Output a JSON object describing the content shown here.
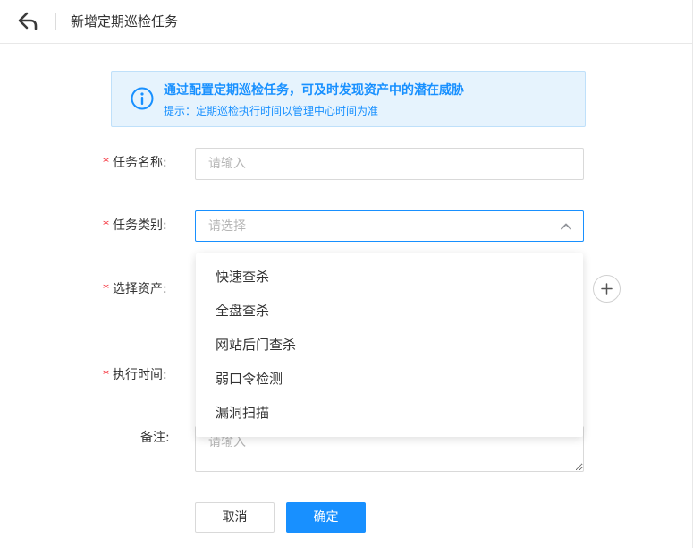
{
  "header": {
    "title": "新增定期巡检任务",
    "back_icon": "back-arrow-icon"
  },
  "alert": {
    "icon": "info-circle-icon",
    "title": "通过配置定期巡检任务，可及时发现资产中的潜在威胁",
    "subtitle": "提示：定期巡检执行时间以管理中心时间为准"
  },
  "form": {
    "required_mark": "*",
    "task_name": {
      "label": "任务名称:",
      "placeholder": "请输入",
      "value": ""
    },
    "task_type": {
      "label": "任务类别:",
      "placeholder": "请选择",
      "icon": "chevron-up-icon"
    },
    "assets": {
      "label": "选择资产:",
      "add_icon": "plus-icon"
    },
    "exec_time": {
      "label": "执行时间:"
    },
    "remark": {
      "label": "备注:",
      "placeholder": "请输入"
    }
  },
  "dropdown": {
    "options": [
      "快速查杀",
      "全盘查杀",
      "网站后门查杀",
      "弱口令检测",
      "漏洞扫描"
    ]
  },
  "buttons": {
    "cancel": "取消",
    "confirm": "确定"
  },
  "colors": {
    "primary": "#1890ff",
    "required": "#f5222d",
    "alert_bg": "#e6f3fd"
  }
}
